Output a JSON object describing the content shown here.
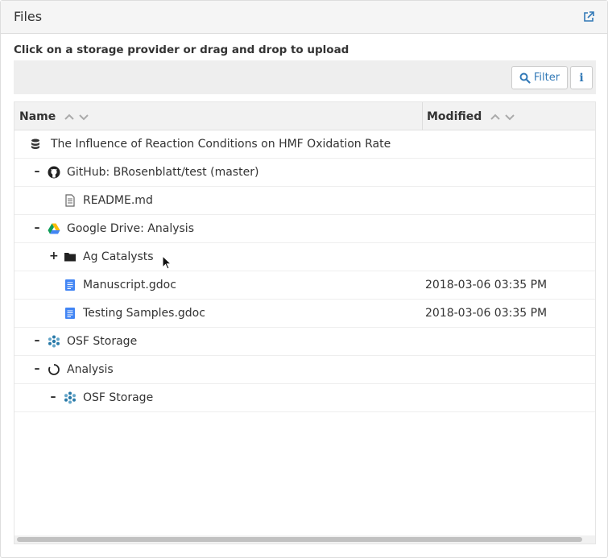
{
  "panel": {
    "title": "Files",
    "external_link_icon": "external-link-icon"
  },
  "instructions": "Click on a storage provider or drag and drop to upload",
  "toolbar": {
    "filter_label": "Filter",
    "info_label": "i"
  },
  "columns": {
    "name": "Name",
    "modified": "Modified"
  },
  "rows": [
    {
      "toggle": "",
      "icon": "database-icon",
      "label": "The Influence of Reaction Conditions on HMF Oxidation Rate",
      "modified": ""
    },
    {
      "toggle": "–",
      "icon": "github-icon",
      "label": "GitHub: BRosenblatt/test (master)",
      "modified": ""
    },
    {
      "toggle": "",
      "icon": "file-text-icon",
      "label": "README.md",
      "modified": ""
    },
    {
      "toggle": "–",
      "icon": "google-drive-icon",
      "label": "Google Drive: Analysis",
      "modified": ""
    },
    {
      "toggle": "+",
      "icon": "folder-icon",
      "label": "Ag Catalysts",
      "modified": ""
    },
    {
      "toggle": "",
      "icon": "google-doc-icon",
      "label": "Manuscript.gdoc",
      "modified": "2018-03-06 03:35 PM"
    },
    {
      "toggle": "",
      "icon": "google-doc-icon",
      "label": "Testing Samples.gdoc",
      "modified": "2018-03-06 03:35 PM"
    },
    {
      "toggle": "–",
      "icon": "osf-storage-icon",
      "label": "OSF Storage",
      "modified": ""
    },
    {
      "toggle": "–",
      "icon": "component-icon",
      "label": "Analysis",
      "modified": ""
    },
    {
      "toggle": "–",
      "icon": "osf-storage-icon",
      "label": "OSF Storage",
      "modified": ""
    }
  ],
  "colors": {
    "accent": "#337ab7",
    "google_doc": "#4285f4",
    "osf": "#2a7aa8"
  }
}
